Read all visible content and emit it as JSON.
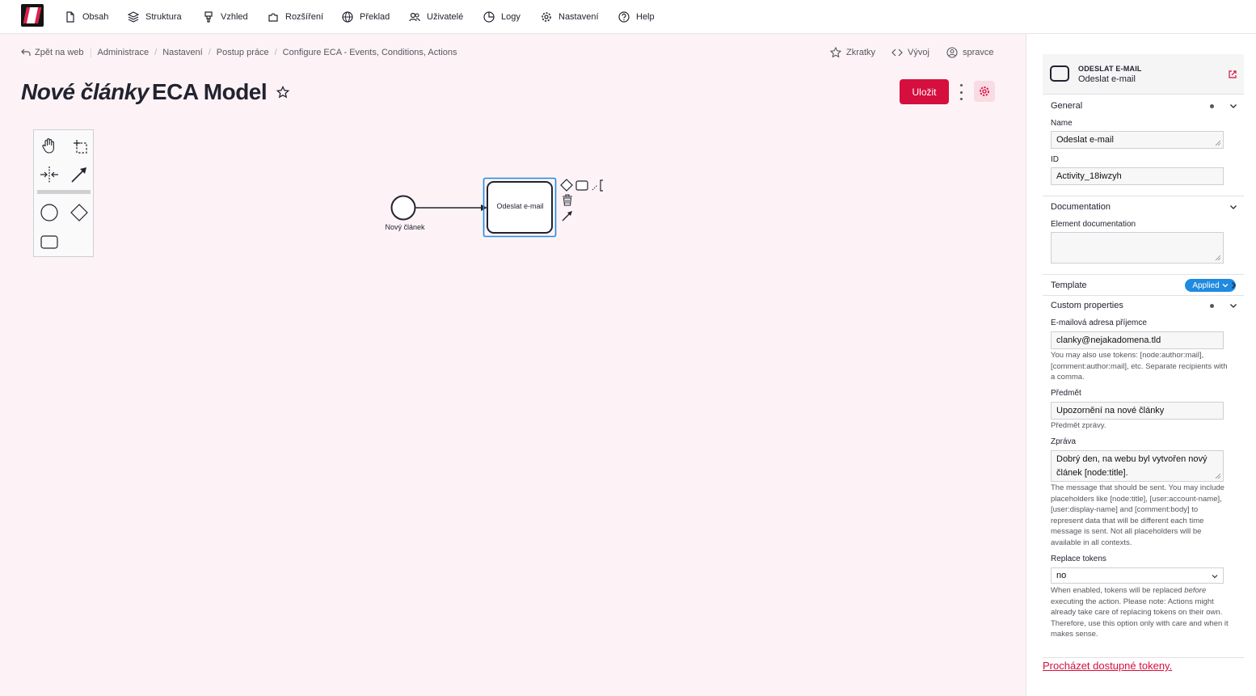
{
  "nav": {
    "items": [
      {
        "label": "Obsah",
        "icon": "file-icon"
      },
      {
        "label": "Struktura",
        "icon": "layers-icon"
      },
      {
        "label": "Vzhled",
        "icon": "brush-icon"
      },
      {
        "label": "Rozšíření",
        "icon": "puzzle-icon"
      },
      {
        "label": "Překlad",
        "icon": "globe-icon"
      },
      {
        "label": "Uživatelé",
        "icon": "users-icon"
      },
      {
        "label": "Logy",
        "icon": "pie-chart-icon"
      },
      {
        "label": "Nastavení",
        "icon": "gear-icon"
      },
      {
        "label": "Help",
        "icon": "help-icon"
      }
    ]
  },
  "breadcrumb": {
    "back": "Zpět na web",
    "items": [
      "Administrace",
      "Nastavení",
      "Postup práce",
      "Configure ECA - Events, Conditions, Actions"
    ]
  },
  "toolbar_right": {
    "shortcuts": "Zkratky",
    "devel": "Vývoj",
    "user": "spravce"
  },
  "page": {
    "title_italic": "Nové články",
    "title_rest": "ECA Model",
    "save_label": "Uložit"
  },
  "diagram": {
    "start_event_label": "Nový článek",
    "task_label": "Odeslat e-mail"
  },
  "panel": {
    "element_type": "ODESLAT E-MAIL",
    "element_name": "Odeslat e-mail",
    "general": {
      "title": "General",
      "name_label": "Name",
      "name_value": "Odeslat e-mail",
      "id_label": "ID",
      "id_value": "Activity_18iwzyh"
    },
    "documentation": {
      "title": "Documentation",
      "label": "Element documentation",
      "value": ""
    },
    "template": {
      "title": "Template",
      "badge": "Applied"
    },
    "custom": {
      "title": "Custom properties",
      "recipient_label": "E-mailová adresa příjemce",
      "recipient_value": "clanky@nejakadomena.tld",
      "recipient_hint": "You may also use tokens: [node:author:mail], [comment:author:mail], etc. Separate recipients with a comma.",
      "subject_label": "Předmět",
      "subject_value": "Upozornění na nové články",
      "subject_hint": "Předmět zprávy.",
      "message_label": "Zpráva",
      "message_value": "Dobrý den, na webu byl vytvořen nový článek [node:title].",
      "message_hint": "The message that should be sent. You may include placeholders like [node:title], [user:account-name], [user:display-name] and [comment:body] to represent data that will be different each time message is sent. Not all placeholders will be available in all contexts.",
      "replace_label": "Replace tokens",
      "replace_value": "no",
      "replace_hint_a": "When enabled, tokens will be replaced ",
      "replace_hint_em": "before",
      "replace_hint_b": " executing the action. Please note: Actions might already take care of replacing tokens on their own. Therefore, use this option only with care and when it makes sense."
    },
    "browse_tokens": "Procházet dostupné tokeny."
  },
  "colors": {
    "accent": "#d50f3e",
    "selection": "#1f8be0",
    "canvas": "#fdf3f6"
  }
}
